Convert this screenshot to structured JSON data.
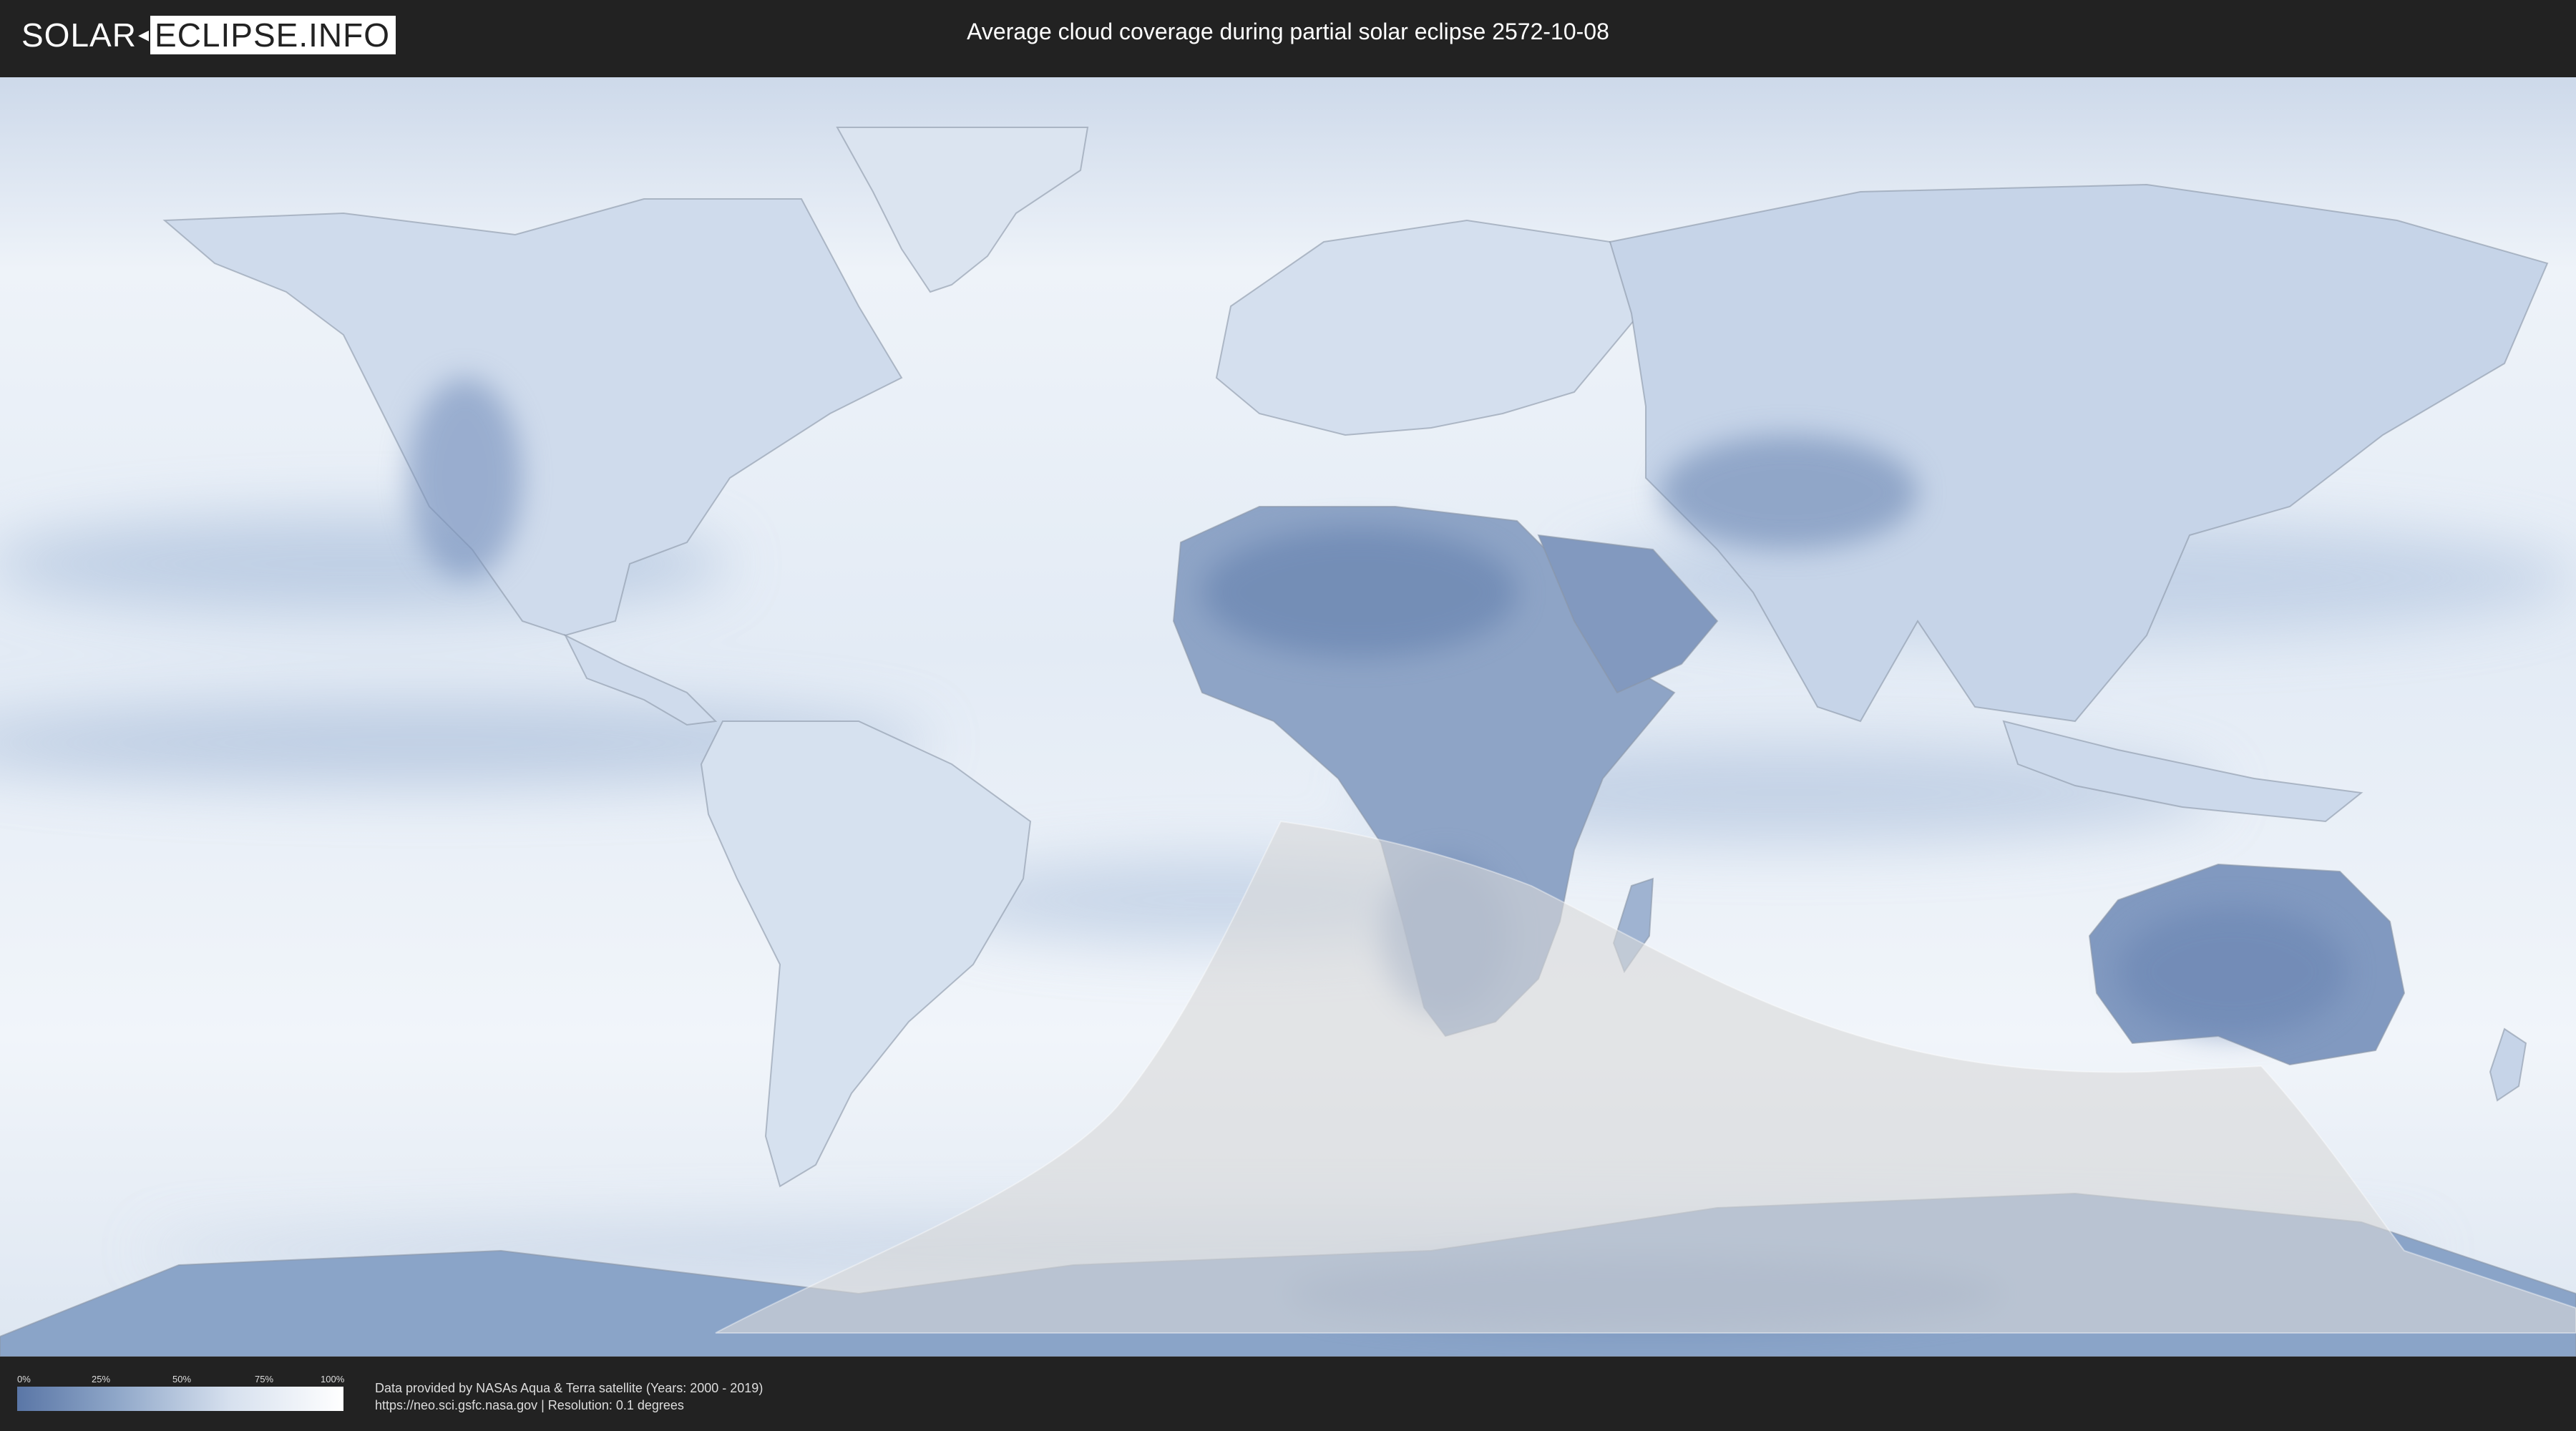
{
  "header": {
    "logo_left": "SOLAR",
    "logo_right": "ECLIPSE.INFO",
    "title": "Average cloud coverage during partial solar eclipse 2572-10-08"
  },
  "map": {
    "kind": "world-equirectangular",
    "ocean_color": "#e9eff7",
    "cloud_low_color": "#5a76a6",
    "cloud_high_color": "#ffffff",
    "eclipse_region_color": "#d9d9d9"
  },
  "legend": {
    "ticks": [
      "0%",
      "25%",
      "50%",
      "75%",
      "100%"
    ],
    "gradient_start": "#5a76a6",
    "gradient_end": "#ffffff"
  },
  "footer": {
    "credit_line1": "Data provided by NASAs Aqua & Terra satellite (Years: 2000 - 2019)",
    "credit_line2": "https://neo.sci.gsfc.nasa.gov | Resolution: 0.1 degrees"
  }
}
